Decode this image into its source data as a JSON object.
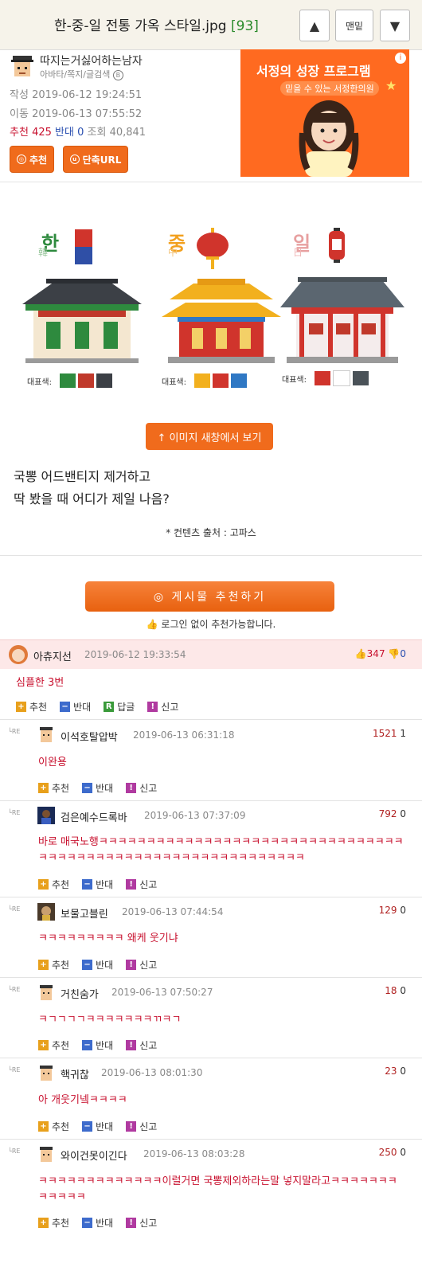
{
  "header": {
    "title": "한-중-일 전통 가옥 스타일.jpg",
    "count": "[93]",
    "up_label": "▲",
    "top_label": "맨밑",
    "down_label": "▼"
  },
  "author": {
    "nick": "따지는거싫어하는남자",
    "links": "아바타/쪽지/글검색"
  },
  "meta": {
    "written_label": "작성",
    "written": "2019-06-12 19:24:51",
    "moved_label": "이동",
    "moved": "2019-06-13 07:55:52",
    "rec_label": "추천",
    "rec": "425",
    "opp_label": "반대",
    "opp": "0",
    "views_label": "조회",
    "views": "40,841"
  },
  "buttons": {
    "recommend": "추천",
    "short_url": "단축URL"
  },
  "ad": {
    "headline": "서정의 성장 프로그램",
    "sub": "믿을 수 있는 서정한의원",
    "info": "i"
  },
  "image": {
    "houses": [
      {
        "tag": "한",
        "sub": "韓",
        "swatch_label": "대표색:",
        "colors": [
          "#2e8a3e",
          "#c0392b",
          "#3c4046"
        ]
      },
      {
        "tag": "중",
        "sub": "中",
        "swatch_label": "대표색:",
        "colors": [
          "#f2b01e",
          "#d0342c",
          "#2f78c4"
        ]
      },
      {
        "tag": "일",
        "sub": "日",
        "swatch_label": "대표색:",
        "colors": [
          "#d0342c",
          "#ffffff",
          "#4a5258"
        ]
      }
    ]
  },
  "view_button": "↑ 이미지 새창에서 보기",
  "body": {
    "line1": "국뽕 어드밴티지 제거하고",
    "line2": "딱 봤을 때 어디가 제일 나음?",
    "source": "* 컨텐츠 출처 : 고파스"
  },
  "recommend_post": {
    "label": "◎ 게시물 추천하기",
    "note": "로그인 없이 추천가능합니다."
  },
  "actions": {
    "rec": "추천",
    "opp": "반대",
    "reply": "답글",
    "report": "신고",
    "re": "RE"
  },
  "best": {
    "nick": "아츄지선",
    "date": "2019-06-12 19:33:54",
    "up": "347",
    "down": "0",
    "text": "심플한 3번"
  },
  "comments": [
    {
      "nick": "이석호탈압박",
      "date": "2019-06-13 06:31:18",
      "up": "1521",
      "down": "1",
      "text": "이완용"
    },
    {
      "nick": "검은예수드록바",
      "date": "2019-06-13 07:37:09",
      "up": "792",
      "down": "0",
      "text": "바로 매국노행ㅋㅋㅋㅋㅋㅋㅋㅋㅋㅋㅋㅋㅋㅋㅋㅋㅋㅋㅋㅋㅋㅋㅋㅋㅋㅋㅋㅋㅋㅋㅋㅋㅋㅋㅋㅋㅋㅋㅋㅋㅋㅋㅋㅋㅋㅋㅋㅋㅋㅋㅋㅋㅋㅋㅋㅋㅋㅋㅋㅋ"
    },
    {
      "nick": "보물고블린",
      "date": "2019-06-13 07:44:54",
      "up": "129",
      "down": "0",
      "text": "ㅋㅋㅋㅋㅋㅋㅋㅋㅋ 왜케 웃기냐"
    },
    {
      "nick": "거친숨가",
      "date": "2019-06-13 07:50:27",
      "up": "18",
      "down": "0",
      "text": "ㅋㄱㄱㄱㄱㅋㅋㅋㅋㅋㅋㅋㄲㅋㄱ"
    },
    {
      "nick": "핵귀찮",
      "date": "2019-06-13 08:01:30",
      "up": "23",
      "down": "0",
      "text": "아 개웃기넼ㅋㅋㅋㅋ"
    },
    {
      "nick": "와이건못이긴다",
      "date": "2019-06-13 08:03:28",
      "up": "250",
      "down": "0",
      "text": "ㅋㅋㅋㅋㅋㅋㅋㅋㅋㅋㅋㅋㅋ이럴거면 국뽕제외하라는말 넣지말라고ㅋㅋㅋㅋㅋㅋㅋㅋㅋㅋㅋㅋ"
    }
  ]
}
